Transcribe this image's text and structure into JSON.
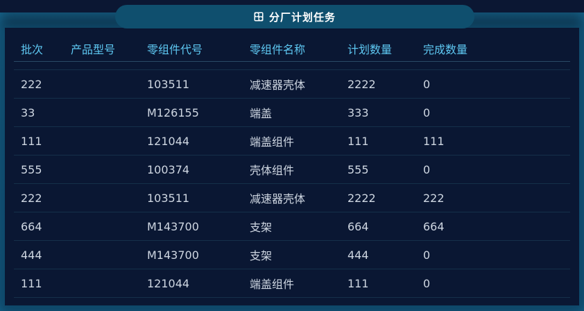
{
  "panel": {
    "title": "分厂计划任务",
    "title_icon": "grid-box-icon"
  },
  "table": {
    "columns": [
      "批次",
      "产品型号",
      "零组件代号",
      "零组件名称",
      "计划数量",
      "完成数量"
    ],
    "rows": [
      [
        "222",
        "",
        "103511",
        "减速器壳体",
        "2222",
        "0"
      ],
      [
        "33",
        "",
        "M126155",
        "端盖",
        "333",
        "0"
      ],
      [
        "111",
        "",
        "121044",
        "端盖组件",
        "111",
        "111"
      ],
      [
        "555",
        "",
        "100374",
        "壳体组件",
        "555",
        "0"
      ],
      [
        "222",
        "",
        "103511",
        "减速器壳体",
        "2222",
        "222"
      ],
      [
        "664",
        "",
        "M143700",
        "支架",
        "664",
        "664"
      ],
      [
        "444",
        "",
        "M143700",
        "支架",
        "444",
        "0"
      ],
      [
        "111",
        "",
        "121044",
        "端盖组件",
        "111",
        "0"
      ]
    ]
  },
  "colors": {
    "header_text": "#5ec8f2",
    "cell_text": "#cfd7e2",
    "tab_bg": "#0f4f6e",
    "panel_bg": "#0a1733"
  }
}
